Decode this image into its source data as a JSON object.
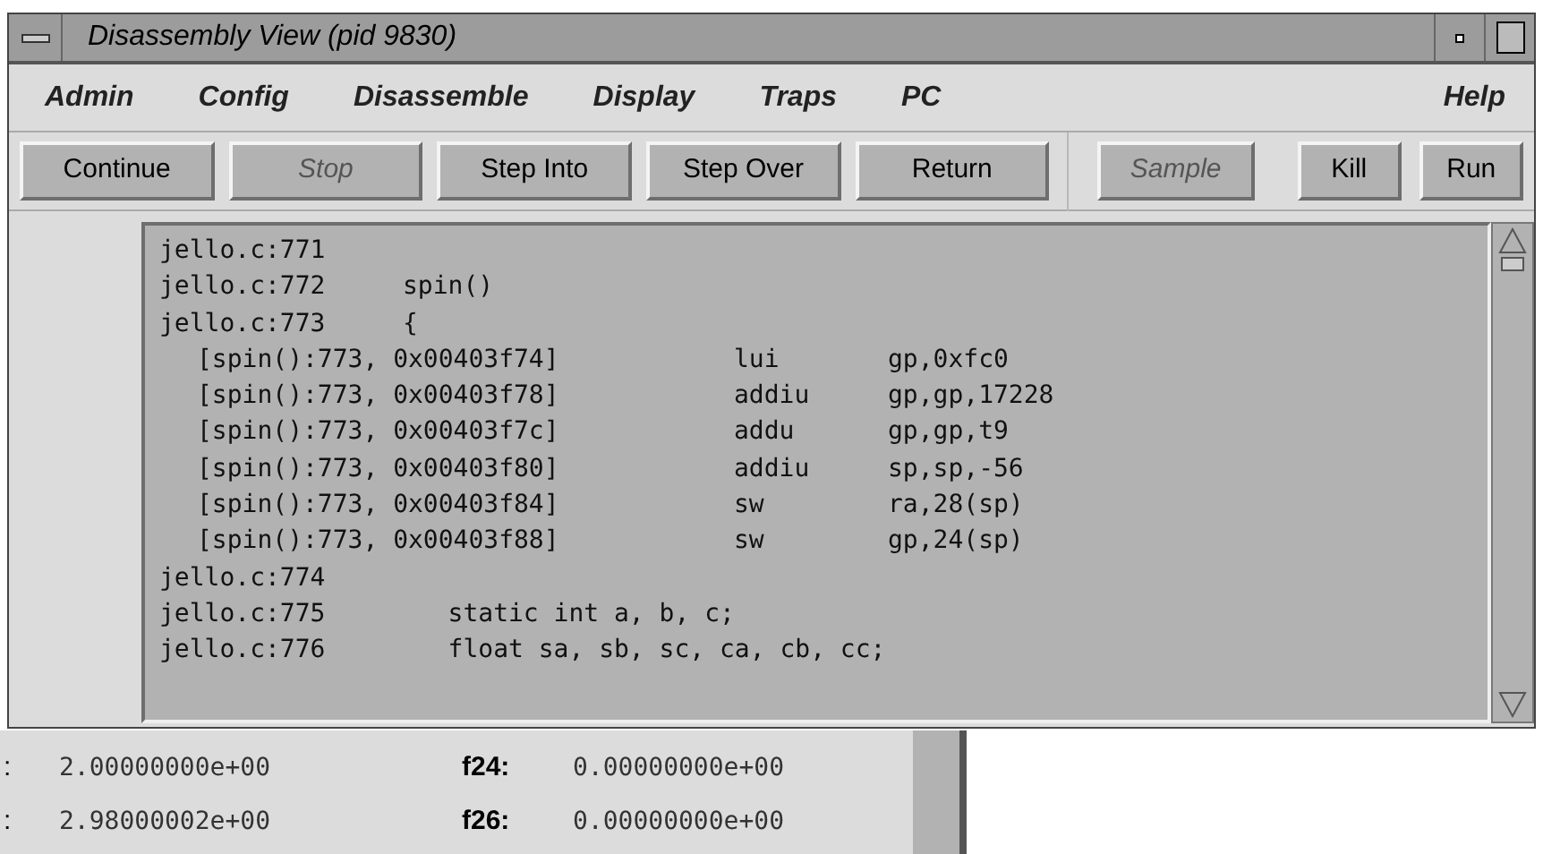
{
  "window": {
    "title": "Disassembly View (pid 9830)"
  },
  "menu": [
    {
      "label": "Admin"
    },
    {
      "label": "Config"
    },
    {
      "label": "Disassemble"
    },
    {
      "label": "Display"
    },
    {
      "label": "Traps"
    },
    {
      "label": "PC"
    },
    {
      "label": "Help"
    }
  ],
  "buttons": [
    {
      "label": "Continue",
      "disabled": false
    },
    {
      "label": "Stop",
      "disabled": true
    },
    {
      "label": "Step Into",
      "disabled": false
    },
    {
      "label": "Step Over",
      "disabled": false
    },
    {
      "label": "Return",
      "disabled": false
    },
    {
      "label": "Sample",
      "disabled": true
    },
    {
      "label": "Kill",
      "disabled": false
    },
    {
      "label": "Run",
      "disabled": false
    }
  ],
  "listing": [
    {
      "kind": "source",
      "location": "jello.c:771"
    },
    {
      "kind": "source",
      "location": "jello.c:772",
      "code": "spin()"
    },
    {
      "kind": "source",
      "location": "jello.c:773",
      "code": "{"
    },
    {
      "kind": "asm",
      "location": "[spin():773, 0x00403f74]",
      "op": "lui",
      "args": "gp,0xfc0"
    },
    {
      "kind": "asm",
      "location": "[spin():773, 0x00403f78]",
      "op": "addiu",
      "args": "gp,gp,17228"
    },
    {
      "kind": "asm",
      "location": "[spin():773, 0x00403f7c]",
      "op": "addu",
      "args": "gp,gp,t9"
    },
    {
      "kind": "asm",
      "location": "[spin():773, 0x00403f80]",
      "op": "addiu",
      "args": "sp,sp,-56"
    },
    {
      "kind": "asm",
      "location": "[spin():773, 0x00403f84]",
      "op": "sw",
      "args": "ra,28(sp)"
    },
    {
      "kind": "asm",
      "location": "[spin():773, 0x00403f88]",
      "op": "sw",
      "args": "gp,24(sp)"
    },
    {
      "kind": "source",
      "location": "jello.c:774"
    },
    {
      "kind": "source",
      "location": "jello.c:775",
      "code": "   static int a, b, c;"
    },
    {
      "kind": "source",
      "location": "jello.c:776",
      "code": "   float sa, sb, sc, ca, cb, cc;"
    }
  ],
  "registers": [
    {
      "column_1": ":",
      "column_2": "2.00000000e+00",
      "name": "f24:",
      "value": "0.00000000e+00"
    },
    {
      "column_1": ":",
      "column_2": "2.98000002e+00",
      "name": "f26:",
      "value": "0.00000000e+00"
    }
  ]
}
